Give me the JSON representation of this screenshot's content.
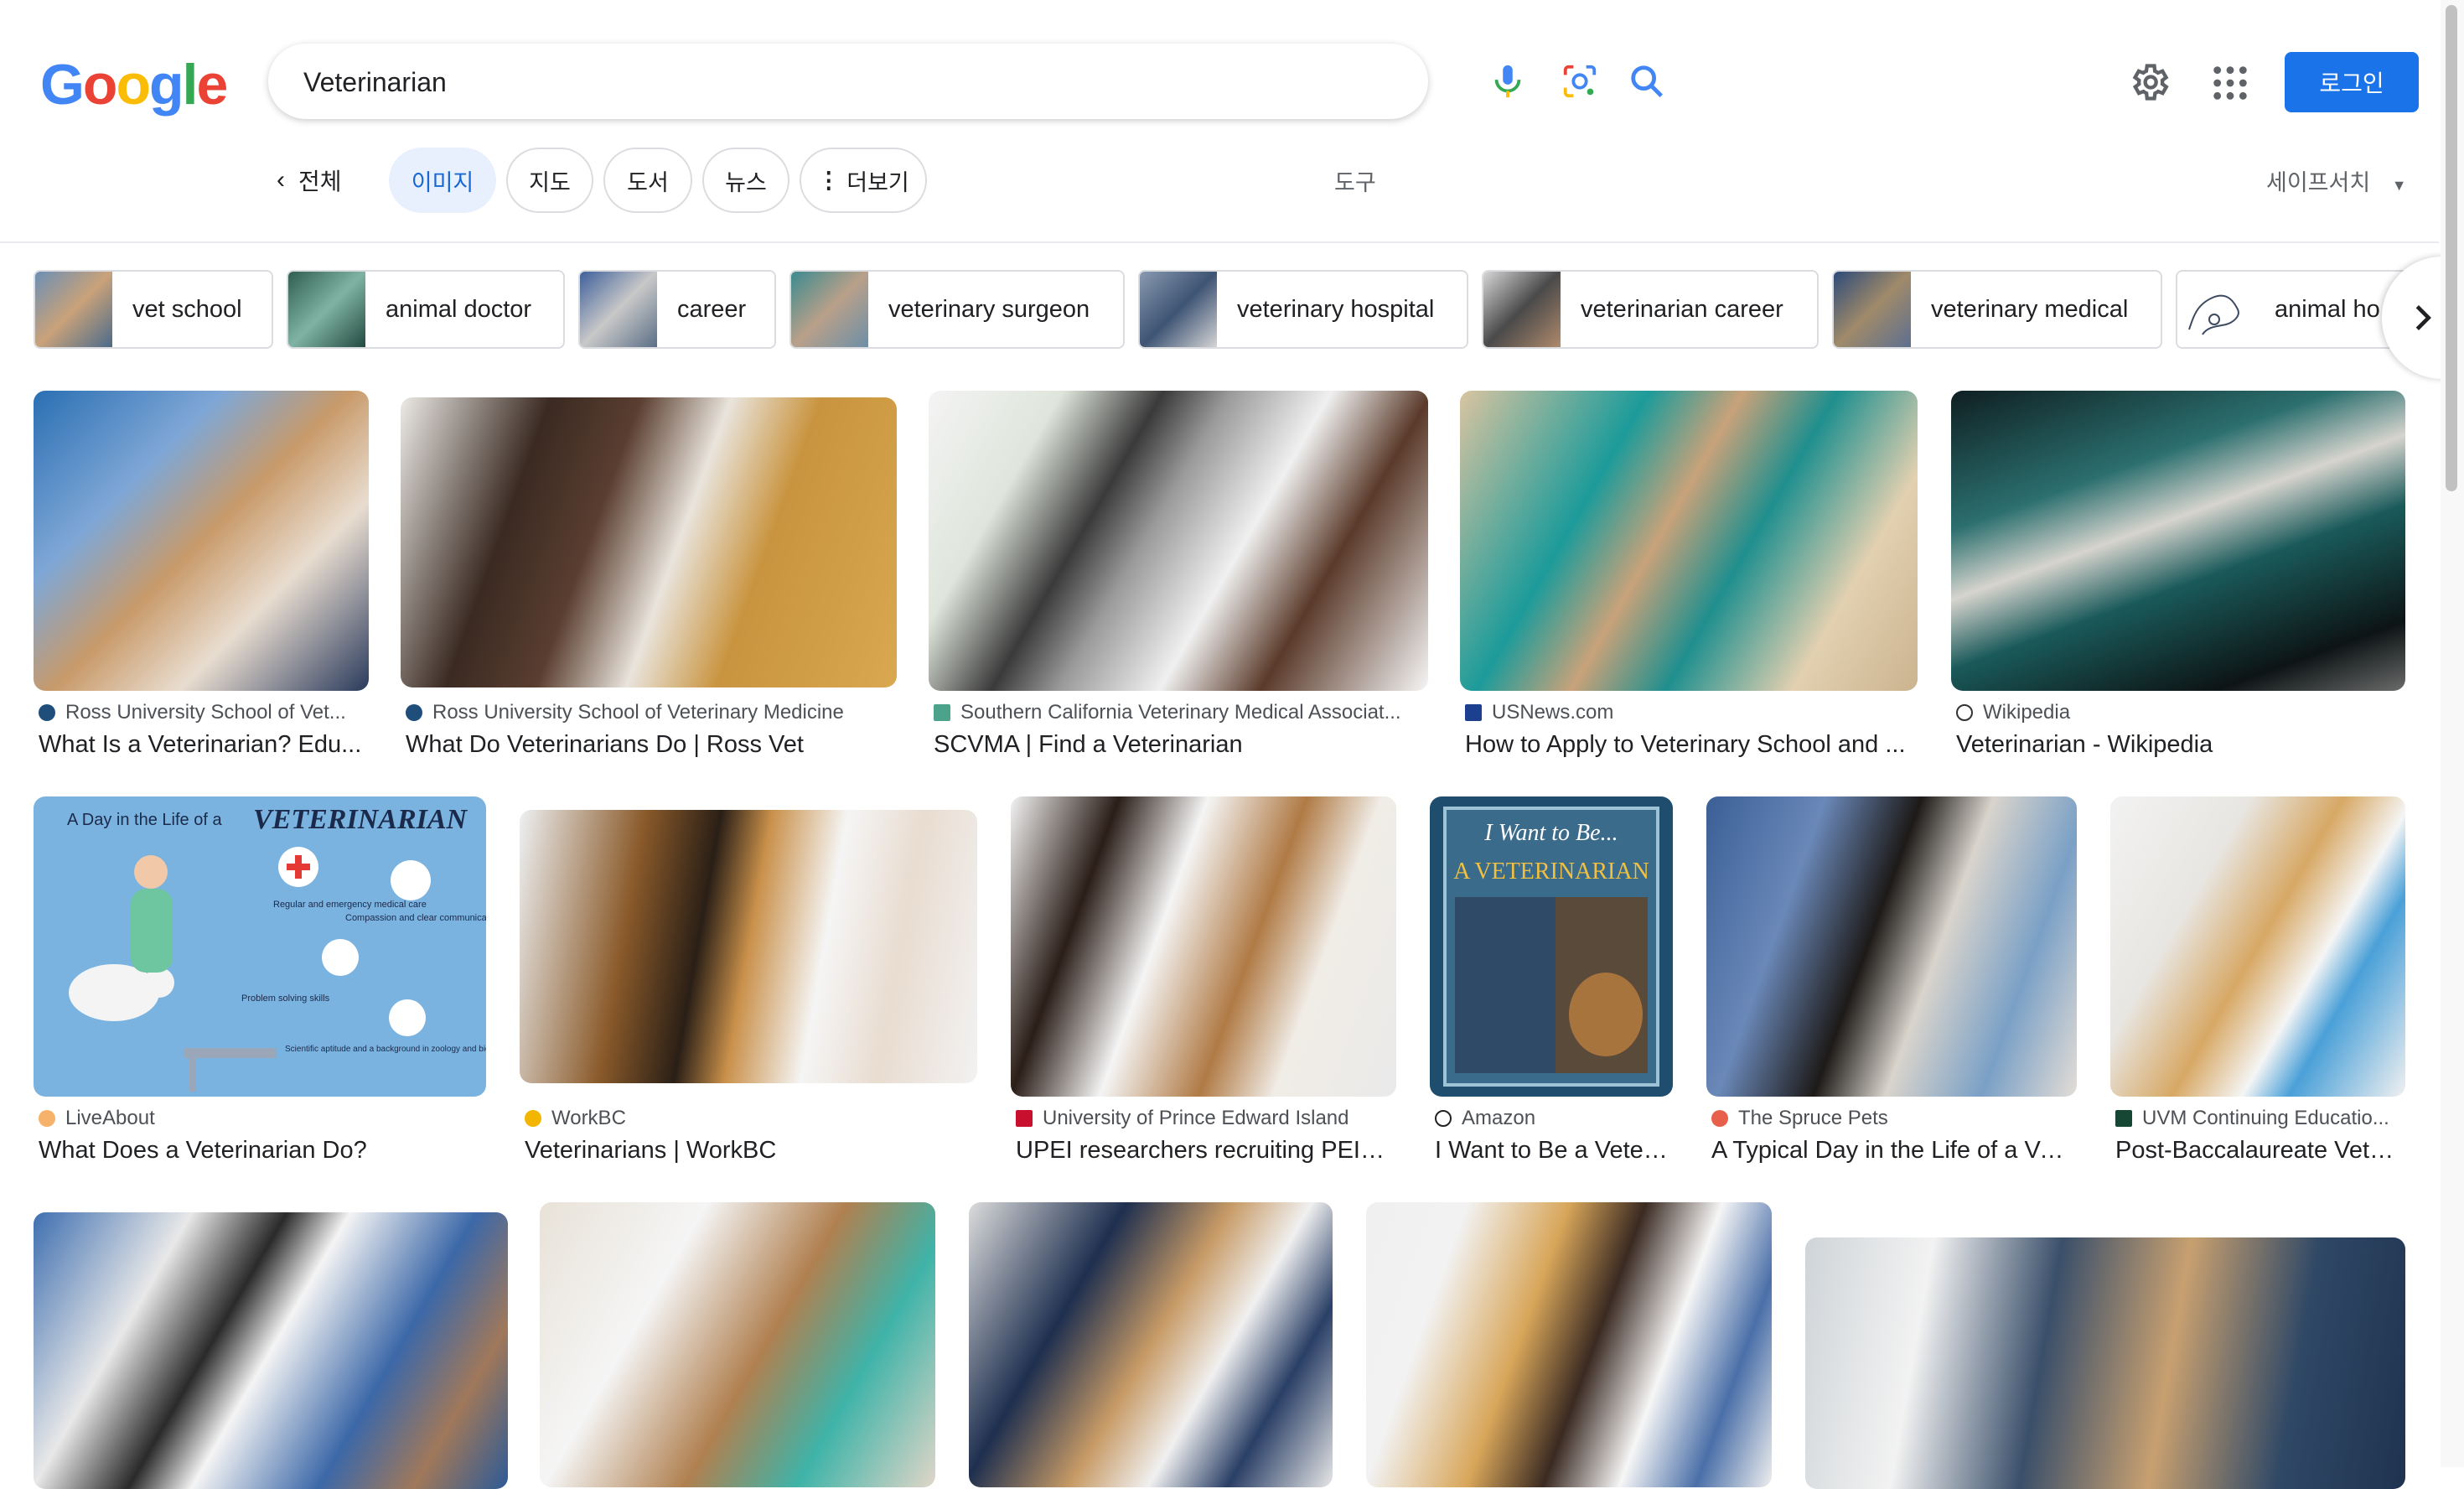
{
  "logo": {
    "text": "Google"
  },
  "search": {
    "query": "Veterinarian",
    "placeholder": ""
  },
  "header": {
    "login_label": "로그인"
  },
  "tabs": {
    "all": "전체",
    "items": [
      "이미지",
      "지도",
      "도서",
      "뉴스"
    ],
    "more": "더보기",
    "tools": "도구",
    "safesearch": "세이프서치"
  },
  "chips": [
    "vet school",
    "animal doctor",
    "career",
    "veterinary surgeon",
    "veterinary hospital",
    "veterinarian career",
    "veterinary medical",
    "animal ho"
  ],
  "results": [
    {
      "source": "Ross University School of Vet...",
      "title": "What Is a Veterinarian? Edu..."
    },
    {
      "source": "Ross University School of Veterinary Medicine",
      "title": "What Do Veterinarians Do | Ross Vet"
    },
    {
      "source": "Southern California Veterinary Medical Associat...",
      "title": "SCVMA | Find a Veterinarian"
    },
    {
      "source": "USNews.com",
      "title": "How to Apply to Veterinary School and ..."
    },
    {
      "source": "Wikipedia",
      "title": "Veterinarian - Wikipedia"
    },
    {
      "source": "LiveAbout",
      "title": "What Does a Veterinarian Do?"
    },
    {
      "source": "WorkBC",
      "title": "Veterinarians | WorkBC"
    },
    {
      "source": "University of Prince Edward Island",
      "title": "UPEI researchers recruiting PEI v..."
    },
    {
      "source": "Amazon",
      "title": "I Want to Be a Veter..."
    },
    {
      "source": "The Spruce Pets",
      "title": "A Typical Day in the Life of a Ve..."
    },
    {
      "source": "UVM Continuing Educatio...",
      "title": "Post-Baccalaureate Vete..."
    }
  ],
  "infographic": {
    "heading_prefix": "A Day in the Life of a",
    "heading_main": "VETERINARIAN",
    "skills": [
      "Regular and emergency medical care",
      "Compassion and clear communication",
      "Problem solving skills",
      "Scientific aptitude and a background in zoology and biology"
    ]
  },
  "book_cover": {
    "line1": "I Want to Be...",
    "line2": "A VETERINARIAN"
  }
}
